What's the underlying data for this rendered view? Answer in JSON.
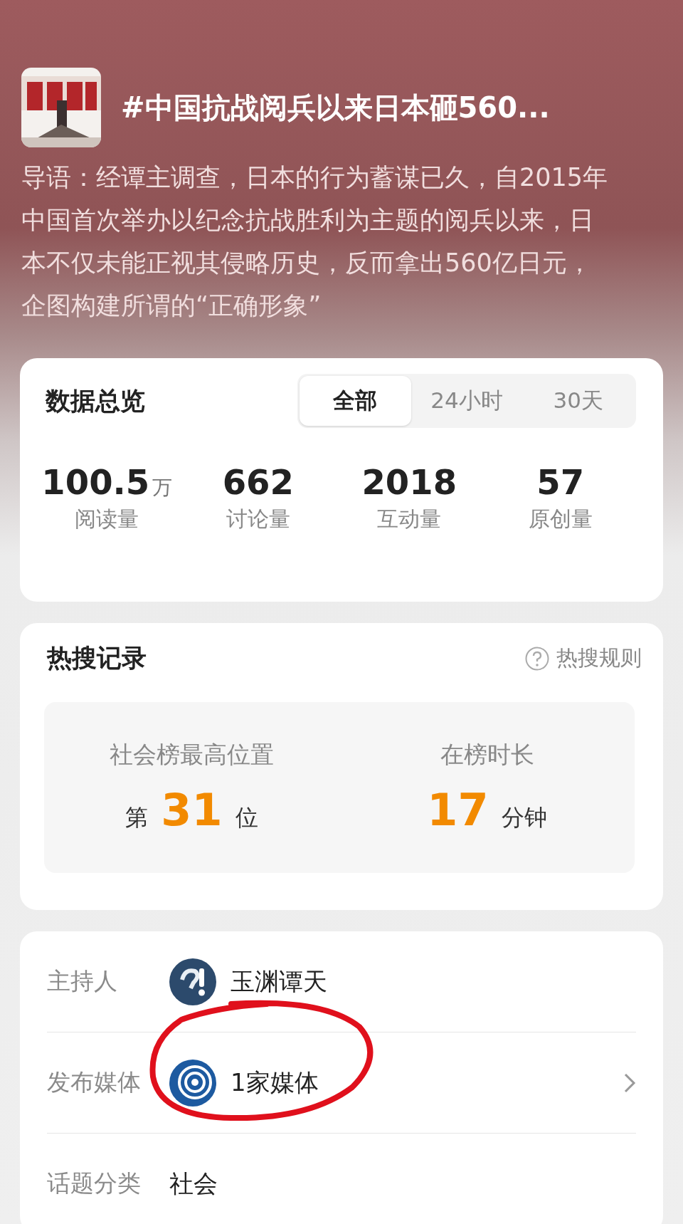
{
  "topic": {
    "title": "#中国抗战阅兵以来日本砸560...",
    "intro_lines": [
      "导语：经谭主调查，日本的行为蓄谋已久，自2015年",
      "中国首次举办以纪念抗战胜利为主题的阅兵以来，日",
      "本不仅未能正视其侵略历史，反而拿出560亿日元，",
      "企图构建所谓的“正确形象”"
    ]
  },
  "overview": {
    "title": "数据总览",
    "tabs": [
      {
        "label": "全部",
        "selected": true
      },
      {
        "label": "24小时",
        "selected": false
      },
      {
        "label": "30天",
        "selected": false
      }
    ],
    "stats": [
      {
        "value": "100.5",
        "unit": "万",
        "label": "阅读量"
      },
      {
        "value": "662",
        "label": "讨论量"
      },
      {
        "value": "2018",
        "label": "互动量"
      },
      {
        "value": "57",
        "label": "原创量"
      }
    ]
  },
  "hot_search": {
    "title": "热搜记录",
    "rules_link": "热搜规则",
    "records": [
      {
        "label": "社会榜最高位置",
        "prefix": "第",
        "value": "31",
        "suffix": "位"
      },
      {
        "label": "在榜时长",
        "value": "17",
        "suffix": "分钟"
      }
    ]
  },
  "info": {
    "rows": [
      {
        "kind": "host",
        "label": "主持人",
        "value": "玉渊谭天",
        "chevron": false
      },
      {
        "kind": "media",
        "label": "发布媒体",
        "value": "1家媒体",
        "chevron": true
      },
      {
        "kind": "plain",
        "label": "话题分类",
        "value": "社会",
        "chevron": false
      }
    ]
  }
}
